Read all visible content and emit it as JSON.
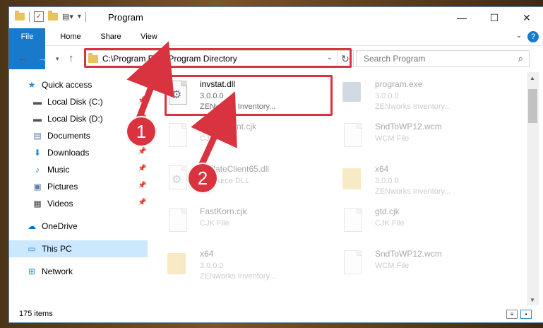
{
  "window": {
    "title": "Program"
  },
  "ribbon": {
    "tabs": [
      "File",
      "Home",
      "Share",
      "View"
    ],
    "help": "?"
  },
  "nav": {
    "address": "C:\\Program Files\\Program Directory",
    "search_placeholder": "Search Program"
  },
  "sidebar": {
    "items": [
      {
        "label": "Quick access",
        "icon": "star-icon",
        "pinned": false
      },
      {
        "label": "Local Disk (C:)",
        "icon": "drive-icon",
        "pinned": true
      },
      {
        "label": "Local Disk (D:)",
        "icon": "drive-icon",
        "pinned": true
      },
      {
        "label": "Documents",
        "icon": "documents-icon",
        "pinned": true
      },
      {
        "label": "Downloads",
        "icon": "download-icon",
        "pinned": true
      },
      {
        "label": "Music",
        "icon": "music-icon",
        "pinned": true
      },
      {
        "label": "Pictures",
        "icon": "pictures-icon",
        "pinned": true
      },
      {
        "label": "Videos",
        "icon": "videos-icon",
        "pinned": true
      },
      {
        "label": "OneDrive",
        "icon": "cloud-icon",
        "pinned": false
      },
      {
        "label": "This PC",
        "icon": "computer-icon",
        "pinned": false,
        "selected": true
      },
      {
        "label": "Network",
        "icon": "network-icon",
        "pinned": false
      }
    ]
  },
  "files": [
    {
      "name": "invstat.dll",
      "line1": "3.0.0.0",
      "line2": "ZENworks   Inventory...",
      "icon": "dll-gear-icon",
      "highlighted": true
    },
    {
      "name": "program.exe",
      "line1": "3.0.0.0",
      "line2": "ZENworks   Inventory...",
      "icon": "exe-icon"
    },
    {
      "name": "DefaultFont.cjk",
      "line1": "CJK File",
      "line2": "",
      "icon": "document-icon"
    },
    {
      "name": "SndToWP12.wcm",
      "line1": "WCM File",
      "line2": "",
      "icon": "document-icon"
    },
    {
      "name": "UpdateClient65.dll",
      "line1": "Resource DLL",
      "line2": "",
      "icon": "dll-gear-icon"
    },
    {
      "name": "x64",
      "line1": "3.0.0.0",
      "line2": "ZENworks   Inventory...",
      "icon": "folder-icon"
    },
    {
      "name": "FastKorn.cjk",
      "line1": "CJK File",
      "line2": "",
      "icon": "document-icon"
    },
    {
      "name": "gtd.cjk",
      "line1": "CJK File",
      "line2": "",
      "icon": "document-icon"
    },
    {
      "name": "x64",
      "line1": "3.0.0.0",
      "line2": "ZENworks   Inventory...",
      "icon": "folder-icon"
    },
    {
      "name": "SndToWP12.wcm",
      "line1": "WCM File",
      "line2": "",
      "icon": "document-icon"
    }
  ],
  "status": {
    "count": "175 items"
  },
  "callouts": [
    "1",
    "2"
  ],
  "colors": {
    "accent": "#1979ca",
    "highlight": "#d9333f",
    "selected": "#cce8ff"
  }
}
